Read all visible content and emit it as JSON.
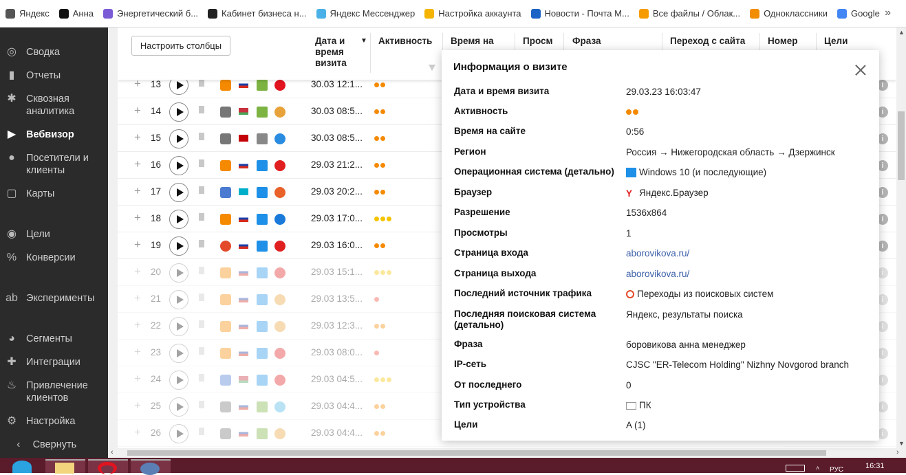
{
  "bookmarks": [
    {
      "label": "Яндекс",
      "icon": "yandex-doc-icon",
      "color": "#555"
    },
    {
      "label": "Анна",
      "icon": "plus-circle-icon",
      "color": "#111"
    },
    {
      "label": "Энергетический б...",
      "icon": "globe-icon",
      "color": "#7b5cd6"
    },
    {
      "label": "Кабинет бизнеса н...",
      "icon": "yandex-business-icon",
      "color": "#222"
    },
    {
      "label": "Яндекс Мессенджер",
      "icon": "messenger-icon",
      "color": "#4ab0e8"
    },
    {
      "label": "Настройка аккаунта",
      "icon": "google-account-icon",
      "color": "#f4b400"
    },
    {
      "label": "Новости - Почта М...",
      "icon": "mail-icon",
      "color": "#1a62c6"
    },
    {
      "label": "Все файлы / Облак...",
      "icon": "cloud-icon",
      "color": "#f59b00"
    },
    {
      "label": "Одноклассники",
      "icon": "ok-icon",
      "color": "#f28c00"
    },
    {
      "label": "Google",
      "icon": "google-icon",
      "color": "#4285f4"
    }
  ],
  "bookmarks_more": "»",
  "sidebar": {
    "items": [
      {
        "label": "Сводка",
        "icon": "dashboard-icon",
        "glyph": "◎",
        "active": false
      },
      {
        "label": "Отчеты",
        "icon": "bar-chart-icon",
        "glyph": "▮",
        "active": false
      },
      {
        "label": "Сквозная аналитика",
        "icon": "snowflake-icon",
        "glyph": "✱",
        "active": false
      },
      {
        "label": "Вебвизор",
        "icon": "play-icon",
        "glyph": "▶",
        "active": true
      },
      {
        "label": "Посетители и клиенты",
        "icon": "person-icon",
        "glyph": "●",
        "active": false
      },
      {
        "label": "Карты",
        "icon": "map-icon",
        "glyph": "▢",
        "active": false
      },
      {
        "label": "Цели",
        "icon": "target-icon",
        "glyph": "◉",
        "active": false
      },
      {
        "label": "Конверсии",
        "icon": "percent-icon",
        "glyph": "%",
        "active": false
      },
      {
        "label": "Эксперименты",
        "icon": "ab-icon",
        "glyph": "ab",
        "active": false
      },
      {
        "label": "Сегменты",
        "icon": "pie-icon",
        "glyph": "◕",
        "active": false
      },
      {
        "label": "Интеграции",
        "icon": "puzzle-icon",
        "glyph": "✚",
        "active": false
      },
      {
        "label": "Привлечение клиентов",
        "icon": "flame-icon",
        "glyph": "♨",
        "active": false
      },
      {
        "label": "Настройка",
        "icon": "gear-icon",
        "glyph": "⚙",
        "active": false
      },
      {
        "label": "Свернуть",
        "icon": "chevron-left-icon",
        "glyph": "‹",
        "active": false
      }
    ]
  },
  "table": {
    "configure_button": "Настроить столбцы",
    "columns": [
      "Дата и время визита",
      "Активность",
      "Время на сайте",
      "Просм",
      "Фраза",
      "Переход с сайта",
      "Номер визита",
      "Цели"
    ],
    "sort_indicator": "▼",
    "rows": [
      {
        "n": "13",
        "dt": "30.03 12:1...",
        "src": "ad",
        "country": "ru",
        "os": "android",
        "browser": "opera",
        "dots": 2,
        "dotcolor": "#f58a00",
        "faded": false
      },
      {
        "n": "14",
        "dt": "30.03 08:5...",
        "src": "direct",
        "country": "by",
        "os": "android",
        "browser": "chrome",
        "dots": 2,
        "dotcolor": "#f58a00",
        "faded": false
      },
      {
        "n": "15",
        "dt": "30.03 08:5...",
        "src": "direct",
        "country": "me",
        "os": "apple",
        "browser": "safari",
        "dots": 2,
        "dotcolor": "#f58a00",
        "faded": false
      },
      {
        "n": "16",
        "dt": "29.03 21:2...",
        "src": "ad",
        "country": "ru",
        "os": "windows",
        "browser": "yandex",
        "dots": 2,
        "dotcolor": "#f58a00",
        "faded": false
      },
      {
        "n": "17",
        "dt": "29.03 20:2...",
        "src": "link",
        "country": "kz",
        "os": "windows",
        "browser": "firefox",
        "dots": 2,
        "dotcolor": "#f58a00",
        "faded": false
      },
      {
        "n": "18",
        "dt": "29.03 17:0...",
        "src": "ad",
        "country": "ru",
        "os": "windows",
        "browser": "edge",
        "dots": 3,
        "dotcolor": "#f5c400",
        "faded": false
      },
      {
        "n": "19",
        "dt": "29.03 16:0...",
        "src": "search",
        "country": "ru",
        "os": "windows",
        "browser": "yandex",
        "dots": 2,
        "dotcolor": "#f58a00",
        "faded": false
      },
      {
        "n": "20",
        "dt": "29.03 15:1...",
        "src": "ad",
        "country": "ru",
        "os": "windows",
        "browser": "yandex",
        "dots": 3,
        "dotcolor": "#f5c400",
        "faded": true
      },
      {
        "n": "21",
        "dt": "29.03 13:5...",
        "src": "ad",
        "country": "ru",
        "os": "windows",
        "browser": "chrome",
        "dots": 1,
        "dotcolor": "#f24a3a",
        "faded": true
      },
      {
        "n": "22",
        "dt": "29.03 12:3...",
        "src": "ad",
        "country": "ru",
        "os": "windows",
        "browser": "chrome",
        "dots": 2,
        "dotcolor": "#f58a00",
        "faded": true
      },
      {
        "n": "23",
        "dt": "29.03 08:0...",
        "src": "ad",
        "country": "ru",
        "os": "windows",
        "browser": "yandex",
        "dots": 1,
        "dotcolor": "#f24a3a",
        "faded": true
      },
      {
        "n": "24",
        "dt": "29.03 04:5...",
        "src": "link",
        "country": "by",
        "os": "windows",
        "browser": "yandex",
        "dots": 3,
        "dotcolor": "#f5c400",
        "faded": true
      },
      {
        "n": "25",
        "dt": "29.03 04:4...",
        "src": "direct",
        "country": "ru",
        "os": "android",
        "browser": "yandex-round",
        "dots": 2,
        "dotcolor": "#f58a00",
        "faded": true
      },
      {
        "n": "26",
        "dt": "29.03 04:4...",
        "src": "direct",
        "country": "ru",
        "os": "android",
        "browser": "chrome",
        "dots": 2,
        "dotcolor": "#f58a00",
        "faded": true
      }
    ]
  },
  "popup": {
    "title": "Информация о визите",
    "fields": [
      {
        "label": "Дата и время визита",
        "value": "29.03.23 16:03:47",
        "type": "text"
      },
      {
        "label": "Активность",
        "value": "",
        "type": "dots"
      },
      {
        "label": "Время на сайте",
        "value": "0:56",
        "type": "text"
      },
      {
        "label": "Регион",
        "value": "Россия → Нижегородская область → Дзержинск",
        "type": "text"
      },
      {
        "label": "Операционная система (детально)",
        "value": "Windows 10 (и последующие)",
        "type": "text",
        "icon": "windows-icon"
      },
      {
        "label": "Браузер",
        "value": "Яндекс.Браузер",
        "type": "text",
        "icon": "yandex-browser-icon"
      },
      {
        "label": "Разрешение",
        "value": "1536x864",
        "type": "text"
      },
      {
        "label": "Просмотры",
        "value": "1",
        "type": "text"
      },
      {
        "label": "Страница входа",
        "value": "aborovikova.ru/",
        "type": "link"
      },
      {
        "label": "Страница выхода",
        "value": "aborovikova.ru/",
        "type": "link"
      },
      {
        "label": "Последний источник трафика",
        "value": "Переходы из поисковых систем",
        "type": "text",
        "icon": "search-magnifier-icon"
      },
      {
        "label": "Последняя поисковая система (детально)",
        "value": "Яндекс, результаты поиска",
        "type": "text"
      },
      {
        "label": "Фраза",
        "value": "боровикова анна менеджер",
        "type": "text"
      },
      {
        "label": "IP-сеть",
        "value": "CJSC \"ER-Telecom Holding\" Nizhny Novgorod branch",
        "type": "text"
      },
      {
        "label": "От последнего",
        "value": "0",
        "type": "text"
      },
      {
        "label": "Тип устройства",
        "value": "ПК",
        "type": "text",
        "icon": "monitor-icon"
      },
      {
        "label": "Цели",
        "value": "A (1)",
        "type": "text"
      }
    ]
  },
  "taskbar": {
    "clock": "16:31",
    "lang": "РУС"
  },
  "colors": {
    "sidebar_bg": "#2b2b2b",
    "link": "#3b5fa8",
    "activity_orange": "#f58a00",
    "activity_yellow": "#f5c400",
    "activity_red": "#f24a3a",
    "taskbar": "#5a1b2a"
  }
}
